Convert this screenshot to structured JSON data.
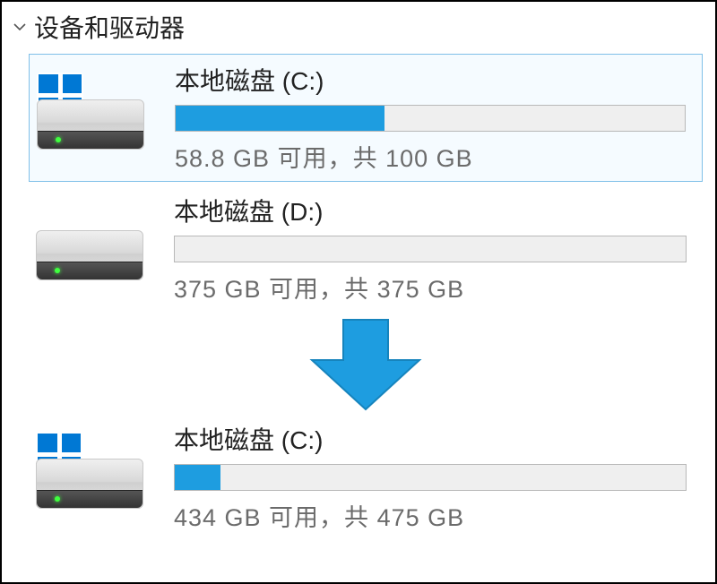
{
  "section": {
    "title": "设备和驱动器"
  },
  "drives": [
    {
      "name": "本地磁盘 (C:)",
      "status": "58.8 GB 可用，共 100 GB",
      "fill_pct": 41,
      "has_os_badge": true,
      "selected": true
    },
    {
      "name": "本地磁盘 (D:)",
      "status": "375 GB 可用，共 375 GB",
      "fill_pct": 0,
      "has_os_badge": false,
      "selected": false
    },
    {
      "name": "本地磁盘 (C:)",
      "status": "434 GB 可用，共 475 GB",
      "fill_pct": 9,
      "has_os_badge": true,
      "selected": false
    }
  ],
  "colors": {
    "accent": "#1e9de0",
    "arrow": "#1e9de0"
  }
}
